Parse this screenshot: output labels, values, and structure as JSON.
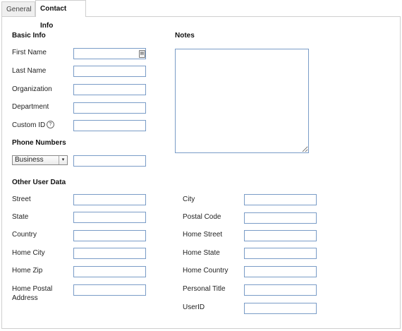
{
  "tabs": [
    {
      "label": "General"
    },
    {
      "label": "Contact Info"
    }
  ],
  "basic_info": {
    "heading": "Basic Info",
    "first_name_label": "First Name",
    "last_name_label": "Last Name",
    "organization_label": "Organization",
    "department_label": "Department",
    "custom_id_label": "Custom ID",
    "help_glyph": "?"
  },
  "notes": {
    "heading": "Notes"
  },
  "phone_numbers": {
    "heading": "Phone Numbers",
    "type_selected": "Business",
    "dropdown_glyph": "▾"
  },
  "other_user_data": {
    "heading": "Other User Data",
    "left_fields": [
      "Street",
      "State",
      "Country",
      "Home City",
      "Home Zip"
    ],
    "home_postal_address_line1": "Home Postal",
    "home_postal_address_line2": "Address",
    "right_fields": [
      "City",
      "Postal Code",
      "Home Street",
      "Home State",
      "Home Country",
      "Personal Title",
      "UserID"
    ]
  },
  "icons": {
    "contact_card_icon": "contact-card-icon",
    "help_icon": "help-icon"
  }
}
